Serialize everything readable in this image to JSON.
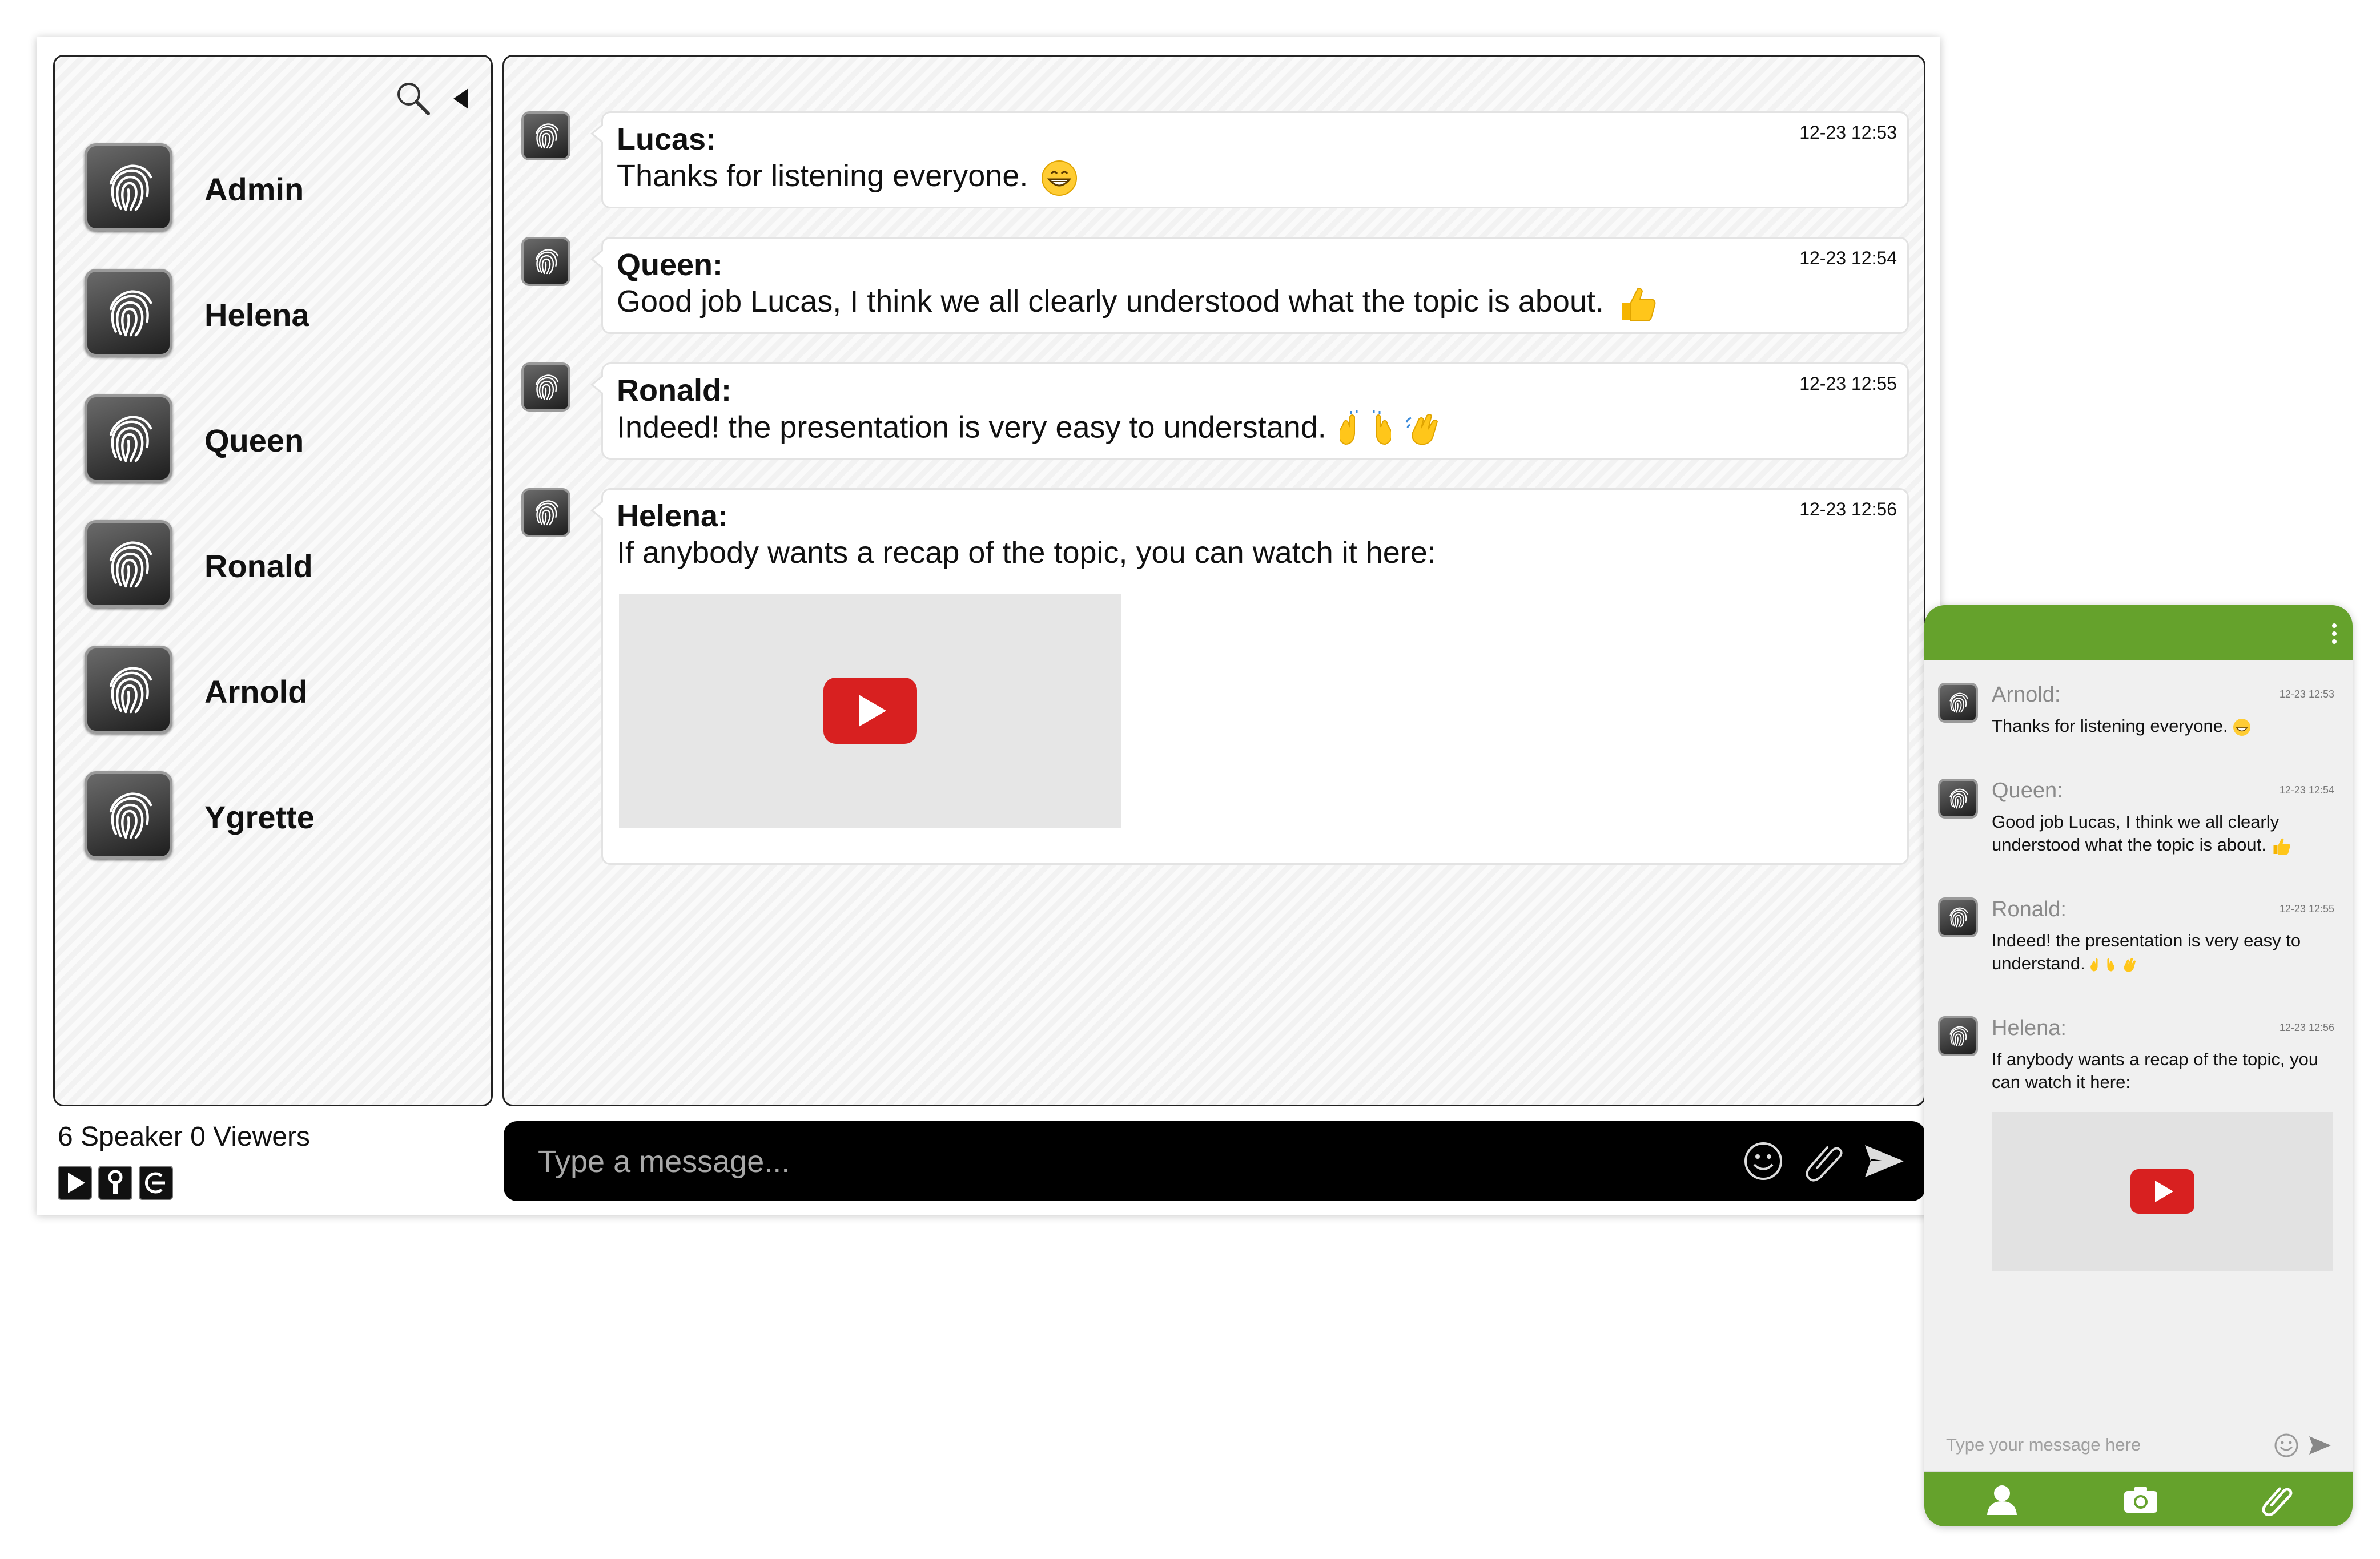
{
  "desktop": {
    "sidebar": {
      "users": [
        {
          "name": "Admin"
        },
        {
          "name": "Helena"
        },
        {
          "name": "Queen"
        },
        {
          "name": "Ronald"
        },
        {
          "name": "Arnold"
        },
        {
          "name": "Ygrette"
        }
      ],
      "search_icon": "search-icon",
      "collapse_icon": "collapse-left-icon"
    },
    "status": {
      "text": "6 Speaker 0 Viewers"
    },
    "controls": [
      "play-icon",
      "wrench-icon",
      "logout-icon"
    ],
    "messages": [
      {
        "author": "Lucas:",
        "time": "12-23 12:53",
        "text": "Thanks for listening everyone.",
        "emoji": [
          "grinning-face-icon"
        ]
      },
      {
        "author": "Queen:",
        "time": "12-23 12:54",
        "text": "Good job Lucas, I think we all clearly understood what the topic is about.",
        "emoji": [
          "thumbs-up-icon"
        ]
      },
      {
        "author": "Ronald:",
        "time": "12-23 12:55",
        "text": "Indeed! the presentation is very easy to understand.",
        "emoji": [
          "raising-hands-icon",
          "waving-hand-icon"
        ]
      },
      {
        "author": "Helena:",
        "time": "12-23 12:56",
        "text": "If anybody wants a recap of the topic, you can watch it here:",
        "video": true
      }
    ],
    "composer": {
      "placeholder": "Type a message...",
      "icons": [
        "emoji-icon",
        "attach-icon",
        "send-icon"
      ]
    }
  },
  "mobile": {
    "header": {
      "menu_icon": "more-vertical-icon"
    },
    "messages": [
      {
        "author": "Arnold:",
        "time": "12-23 12:53",
        "text": "Thanks for listening everyone.",
        "emoji": [
          "grinning-face-icon"
        ]
      },
      {
        "author": "Queen:",
        "time": "12-23 12:54",
        "text": "Good job Lucas, I think we all clearly understood what the topic is about.",
        "emoji": [
          "thumbs-up-icon"
        ]
      },
      {
        "author": "Ronald:",
        "time": "12-23 12:55",
        "text": "Indeed! the presentation is very easy to understand.",
        "emoji": [
          "raising-hands-icon",
          "waving-hand-icon"
        ]
      },
      {
        "author": "Helena:",
        "time": "12-23 12:56",
        "text": "If anybody wants a recap of the topic, you can watch it here:",
        "video": true
      }
    ],
    "composer": {
      "placeholder": "Type your message here"
    },
    "toolbar": [
      "user-icon",
      "camera-icon",
      "attach-icon"
    ]
  },
  "colors": {
    "accent_green": "#65a22c",
    "youtube_red": "#d82020",
    "composer_bg": "#000000"
  }
}
